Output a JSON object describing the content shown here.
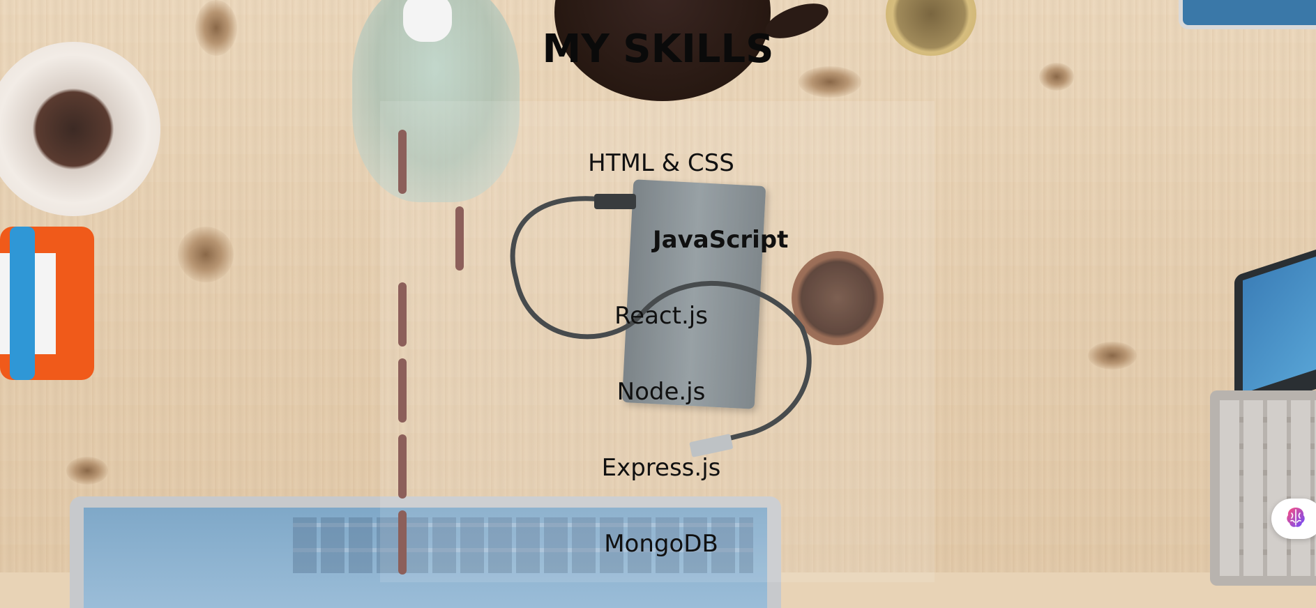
{
  "page": {
    "title": "MY SKILLS"
  },
  "skills": [
    {
      "label": "HTML & CSS"
    },
    {
      "label": "JavaScript"
    },
    {
      "label": "React.js"
    },
    {
      "label": "Node.js"
    },
    {
      "label": "Express.js"
    },
    {
      "label": "MongoDB"
    }
  ],
  "colors": {
    "marker": "#8c5f5a",
    "title_text": "#0a0a0a"
  },
  "floating_button": {
    "icon": "brain-icon"
  }
}
